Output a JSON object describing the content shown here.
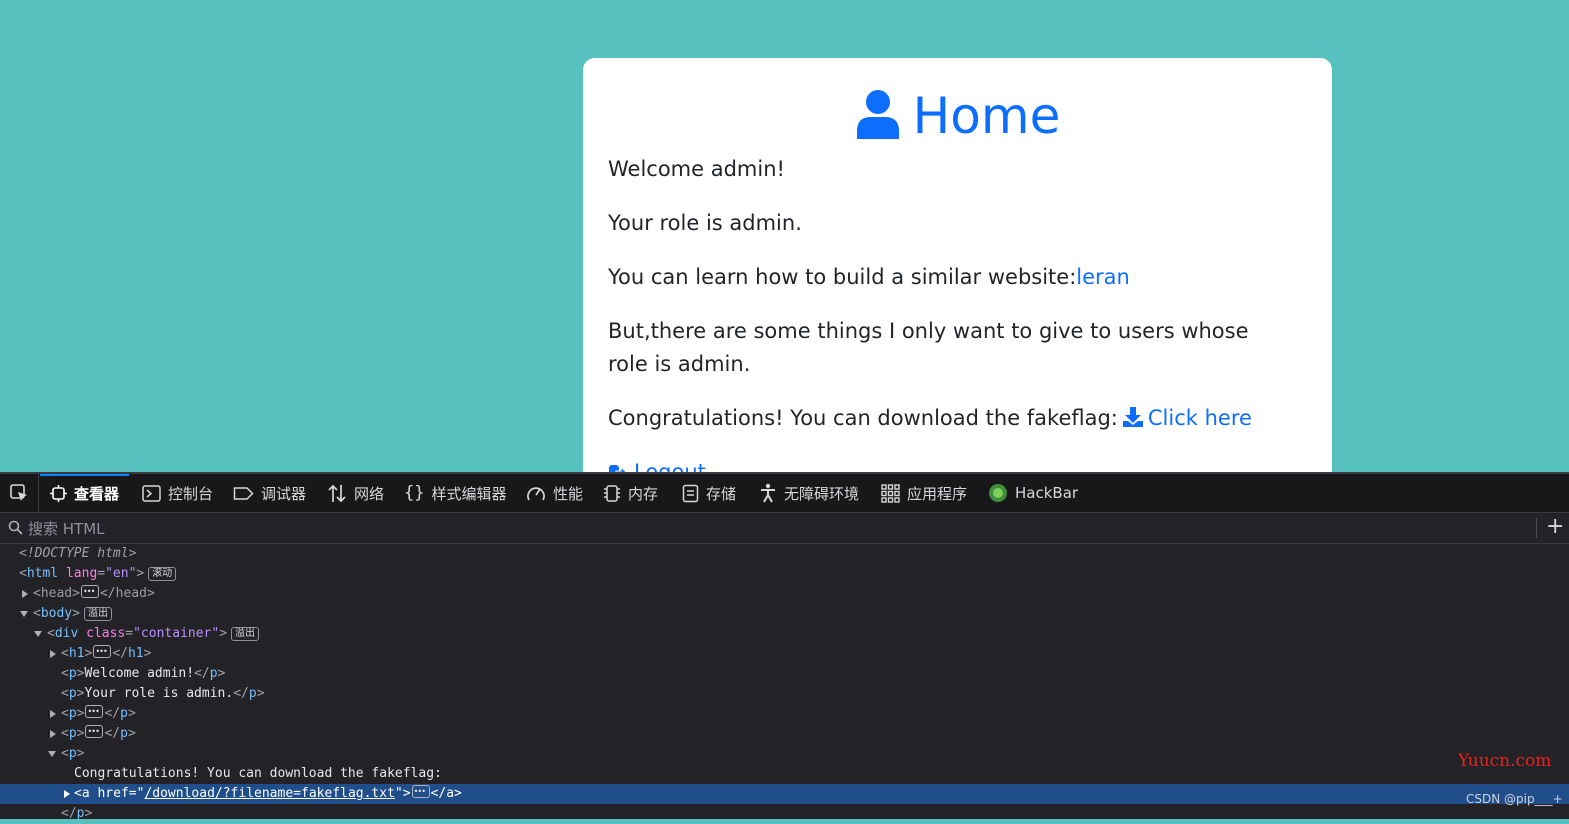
{
  "page": {
    "heading": "Home",
    "welcome": "Welcome admin!",
    "role": "Your role is admin.",
    "learn_prefix": "You can learn how to build a similar website:",
    "learn_link": "leran",
    "things": "But,there are some things I only want to give to users whose role is admin.",
    "congrats": "Congratulations! You can download the fakeflag:",
    "download_link": "Click here",
    "logout_link": "Logout"
  },
  "devtools": {
    "tabs": [
      {
        "label": "查看器",
        "icon": "inspector-icon",
        "active": true
      },
      {
        "label": "控制台",
        "icon": "console-icon"
      },
      {
        "label": "调试器",
        "icon": "debugger-icon"
      },
      {
        "label": "网络",
        "icon": "network-icon"
      },
      {
        "label": "样式编辑器",
        "icon": "style-editor-icon"
      },
      {
        "label": "性能",
        "icon": "performance-icon"
      },
      {
        "label": "内存",
        "icon": "memory-icon"
      },
      {
        "label": "存储",
        "icon": "storage-icon"
      },
      {
        "label": "无障碍环境",
        "icon": "accessibility-icon"
      },
      {
        "label": "应用程序",
        "icon": "application-icon"
      },
      {
        "label": "HackBar",
        "icon": "hackbar-icon"
      }
    ],
    "search_placeholder": "搜索 HTML",
    "tree": {
      "doctype": "<!DOCTYPE html>",
      "html_tag": "html",
      "html_attr": "lang",
      "html_val": "\"en\"",
      "badge_scroll": "滚动",
      "head_tag": "head",
      "body_tag": "body",
      "badge_overflow": "溢出",
      "div_tag": "div",
      "div_attr": "class",
      "div_val": "\"container\"",
      "h1_tag": "h1",
      "p_tag": "p",
      "p1_text": "Welcome admin!",
      "p2_text": "Your role is admin.",
      "p5_text": "Congratulations! You can download the fakeflag:",
      "a_tag": "a",
      "a_attr": "href",
      "a_val": "/download/?filename=fakeflag.txt"
    }
  },
  "watermarks": {
    "site": "Yuucn.com",
    "csdn": "CSDN @pip___+"
  }
}
